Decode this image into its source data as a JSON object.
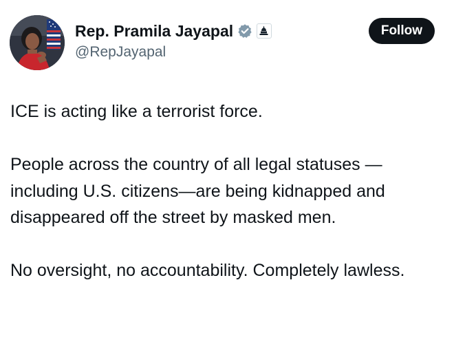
{
  "author": {
    "display_name": "Rep. Pramila Jayapal",
    "handle": "@RepJayapal",
    "verified_icon": "verified-badge-icon",
    "affiliation_icon": "us-capitol-icon",
    "avatar_icon": "profile-photo"
  },
  "actions": {
    "follow_label": "Follow"
  },
  "tweet": {
    "paragraphs": [
      "ICE is acting like a terrorist force.",
      "People across the country of all legal statuses —including U.S. citizens—are being kidnapped and disappeared off the street by masked men.",
      "No oversight, no accountability. Completely lawless."
    ]
  },
  "colors": {
    "text_primary": "#0f1419",
    "text_secondary": "#536471",
    "verified_grey": "#829aab",
    "follow_bg": "#0f1419",
    "follow_text": "#ffffff"
  }
}
